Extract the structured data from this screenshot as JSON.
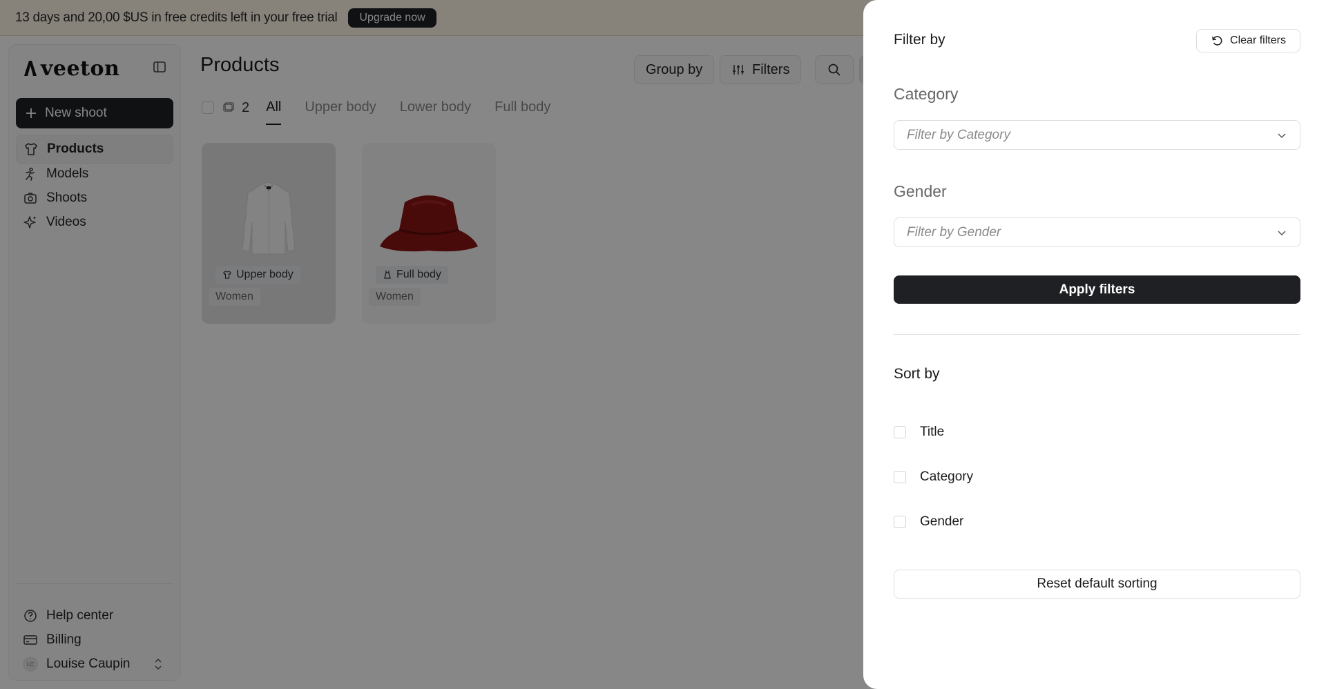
{
  "banner": {
    "message": "13 days and 20,00 $US in free credits left in your free trial",
    "upgrade_label": "Upgrade now"
  },
  "sidebar": {
    "logo_text": "veeton",
    "new_shoot_label": "New shoot",
    "items": [
      {
        "label": "Products",
        "icon": "shirt-icon",
        "active": true
      },
      {
        "label": "Models",
        "icon": "person-icon"
      },
      {
        "label": "Shoots",
        "icon": "camera-icon"
      },
      {
        "label": "Videos",
        "icon": "sparkle-icon"
      }
    ],
    "footer": [
      {
        "label": "Help center",
        "icon": "help-icon"
      },
      {
        "label": "Billing",
        "icon": "card-icon"
      }
    ],
    "user": {
      "initials": "LC",
      "name": "Louise Caupin"
    }
  },
  "main": {
    "title": "Products",
    "group_by_label": "Group by",
    "filters_label": "Filters",
    "count": "2",
    "tabs": [
      "All",
      "Upper body",
      "Lower body",
      "Full body"
    ],
    "products": [
      {
        "category": "Upper body",
        "gender": "Women",
        "image": "white-shirt"
      },
      {
        "category": "Full body",
        "gender": "Women",
        "image": "red-hat"
      }
    ]
  },
  "panel": {
    "title": "Filter by",
    "clear_label": "Clear filters",
    "category_label": "Category",
    "category_placeholder": "Filter by Category",
    "gender_label": "Gender",
    "gender_placeholder": "Filter by Gender",
    "apply_label": "Apply filters",
    "sort_title": "Sort by",
    "sort_options": [
      "Title",
      "Category",
      "Gender"
    ],
    "reset_label": "Reset default sorting"
  },
  "colors": {
    "primary_dark": "#1f2024",
    "banner_bg": "#fff7e8",
    "overlay": "rgba(0,0,0,0.47)"
  }
}
